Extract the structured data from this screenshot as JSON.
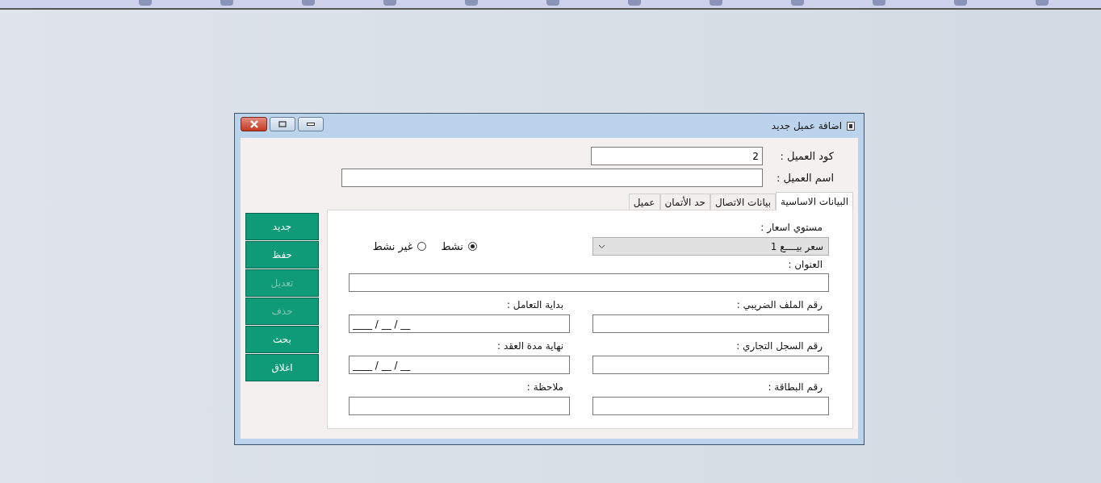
{
  "window": {
    "title": "اضافة عميل جديد"
  },
  "customer_code": {
    "label": "كود العميل :",
    "value": "2"
  },
  "customer_name": {
    "label": "اسم العميل :"
  },
  "tabs": [
    {
      "label": "البيانات الاساسية",
      "selected": true
    },
    {
      "label": "بيانات الاتصال",
      "selected": false
    },
    {
      "label": "حد الأتمان",
      "selected": false
    },
    {
      "label": "عميل",
      "selected": false
    }
  ],
  "price_level": {
    "label": "مستوي اسعار :",
    "value": "سعر بيــــع 1"
  },
  "statuses": [
    {
      "label": "نشط",
      "selected": true
    },
    {
      "label": "غير نشط",
      "selected": false
    }
  ],
  "address": {
    "label": "العنوان :"
  },
  "fields": [
    {
      "label": "رقم الملف الضريبي :",
      "kind": "text"
    },
    {
      "label": "بداية التعامل :",
      "kind": "date",
      "value": "____ / __ / __"
    },
    {
      "label": "رقم السجل التجاري :",
      "kind": "text"
    },
    {
      "label": "نهاية مدة العقد :",
      "kind": "date",
      "value": "____ / __ / __"
    },
    {
      "label": "رقم البطاقة :",
      "kind": "text"
    },
    {
      "label": "ملاحظة :",
      "kind": "text"
    }
  ],
  "buttons": [
    {
      "label": "جديد",
      "disabled": false
    },
    {
      "label": "حفظ",
      "disabled": false
    },
    {
      "label": "تعديل",
      "disabled": true
    },
    {
      "label": "حذف",
      "disabled": true
    },
    {
      "label": "بحث",
      "disabled": false
    },
    {
      "label": "اغلاق",
      "disabled": false
    }
  ]
}
